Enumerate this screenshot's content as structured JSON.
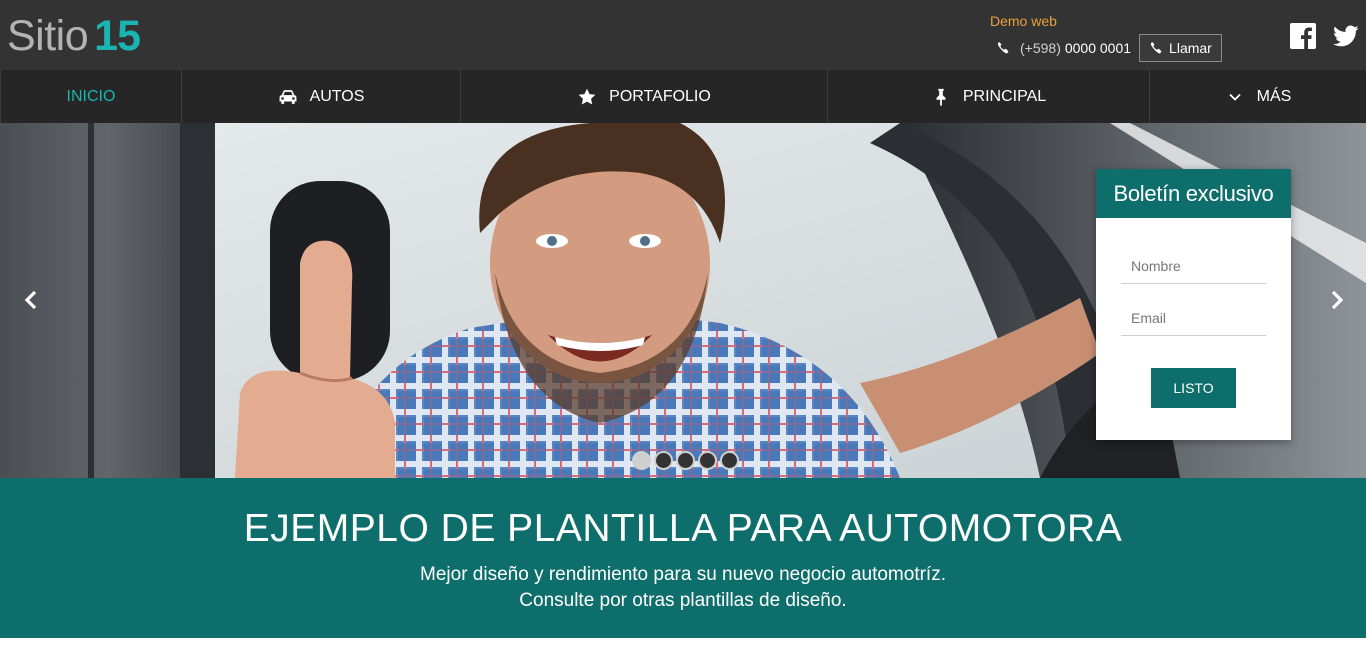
{
  "header": {
    "logo_word": "Sitio",
    "logo_number": "15",
    "demo_label": "Demo web",
    "phone_prefix": "(+598)",
    "phone_number": "0000 0001",
    "call_label": "Llamar"
  },
  "social": {
    "facebook": "facebook-icon",
    "twitter": "twitter-icon"
  },
  "nav": {
    "items": [
      {
        "label": "INICIO",
        "icon": "",
        "active": true
      },
      {
        "label": "AUTOS",
        "icon": "car-icon"
      },
      {
        "label": "PORTAFOLIO",
        "icon": "star-icon"
      },
      {
        "label": "PRINCIPAL",
        "icon": "pin-icon"
      },
      {
        "label": "MÁS",
        "icon": "chevron-down-icon"
      }
    ]
  },
  "slider": {
    "total_slides": 5,
    "active_slide": 1
  },
  "newsletter": {
    "title": "Boletín exclusivo",
    "name_placeholder": "Nombre",
    "email_placeholder": "Email",
    "submit_label": "LISTO"
  },
  "banner": {
    "title": "EJEMPLO DE PLANTILLA PARA AUTOMOTORA",
    "line1": "Mejor diseño y rendimiento para su nuevo negocio automotríz.",
    "line2": "Consulte por otras plantillas de diseño."
  },
  "colors": {
    "accent": "#1ab5b1",
    "brand_dark_teal": "#0e6e6b",
    "demo_orange": "#e9a13b",
    "header_bg": "#333333",
    "nav_bg": "#262626"
  }
}
